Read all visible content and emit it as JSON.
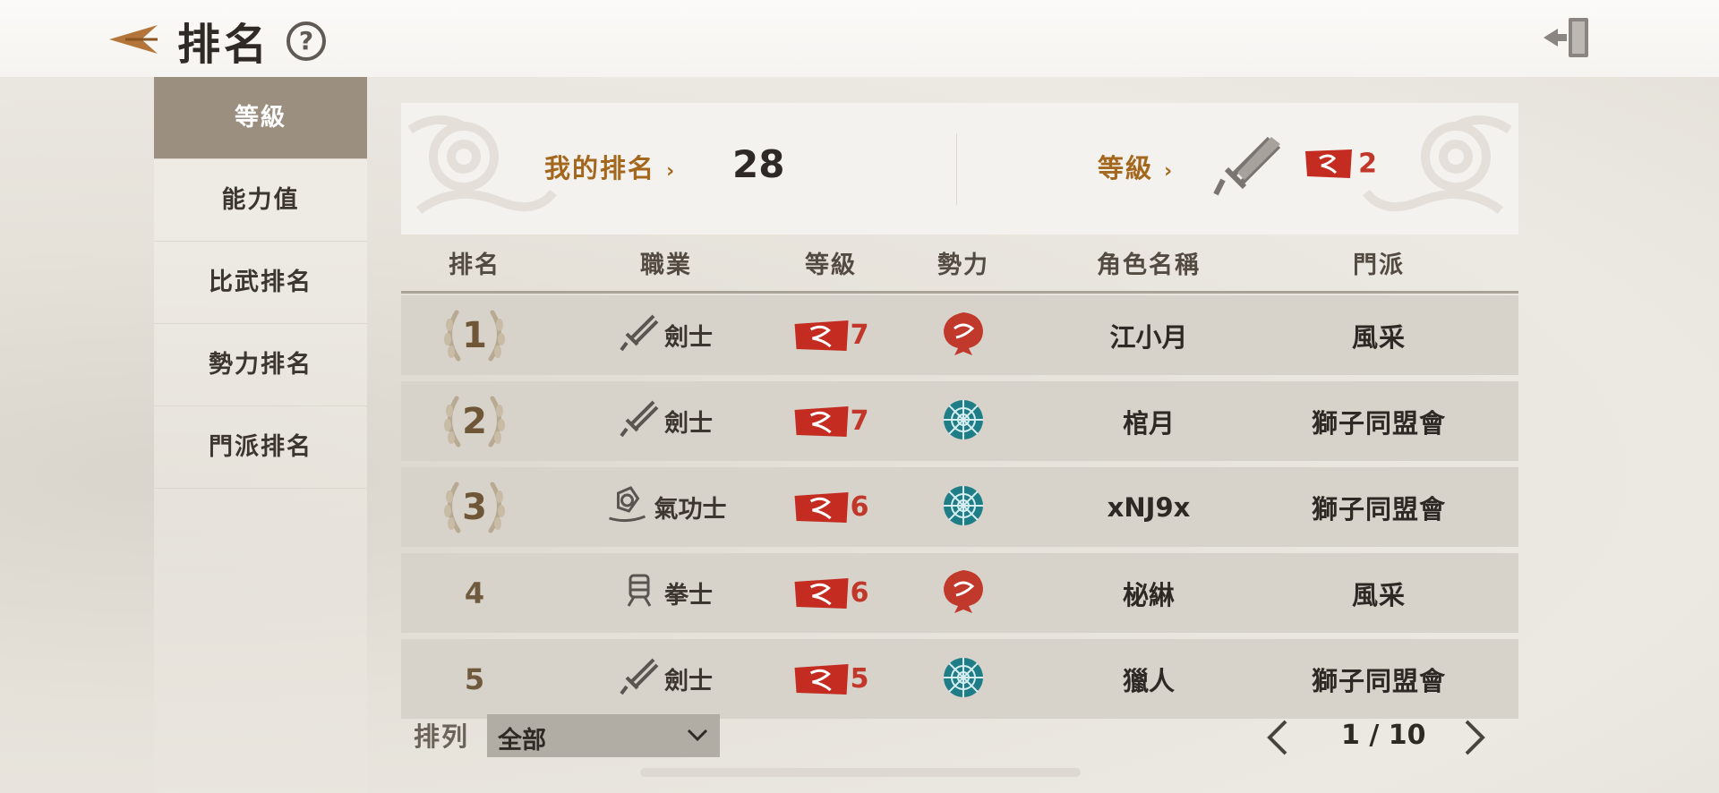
{
  "header": {
    "title": "排名",
    "back_icon": "back-arrow-icon",
    "help_icon": "question-icon",
    "exit_icon": "exit-door-icon"
  },
  "sidebar": {
    "items": [
      {
        "label": "等級",
        "active": true
      },
      {
        "label": "能力值",
        "active": false
      },
      {
        "label": "比武排名",
        "active": false
      },
      {
        "label": "勢力排名",
        "active": false
      },
      {
        "label": "門派排名",
        "active": false
      }
    ]
  },
  "summary": {
    "my_rank_label": "我的排名",
    "my_rank_value": "28",
    "level_label": "等級",
    "level_value": "2"
  },
  "table": {
    "columns": [
      "排名",
      "職業",
      "等級",
      "勢力",
      "角色名稱",
      "門派"
    ],
    "rows": [
      {
        "rank": "1",
        "job": "劍士",
        "job_icon": "sword-icon",
        "level": "7",
        "faction_icon": "red-beast-faction-icon",
        "name": "江小月",
        "guild": "風采"
      },
      {
        "rank": "2",
        "job": "劍士",
        "job_icon": "sword-icon",
        "level": "7",
        "faction_icon": "teal-lotus-faction-icon",
        "name": "棺月",
        "guild": "獅子同盟會"
      },
      {
        "rank": "3",
        "job": "氣功士",
        "job_icon": "qigong-icon",
        "level": "6",
        "faction_icon": "teal-lotus-faction-icon",
        "name": "xNJ9x",
        "guild": "獅子同盟會"
      },
      {
        "rank": "4",
        "job": "拳士",
        "job_icon": "fist-icon",
        "level": "6",
        "faction_icon": "red-beast-faction-icon",
        "name": "柲綝",
        "guild": "風采"
      },
      {
        "rank": "5",
        "job": "劍士",
        "job_icon": "sword-icon",
        "level": "5",
        "faction_icon": "teal-lotus-faction-icon",
        "name": "獵人",
        "guild": "獅子同盟會"
      }
    ]
  },
  "footer": {
    "sort_label": "排列",
    "sort_value": "全部",
    "page_indicator": "1 / 10"
  },
  "colors": {
    "accent": "#a3681e",
    "sidebar_active": "#9b8f80",
    "level_red": "#c1372a",
    "faction_teal": "#1f7d87"
  }
}
